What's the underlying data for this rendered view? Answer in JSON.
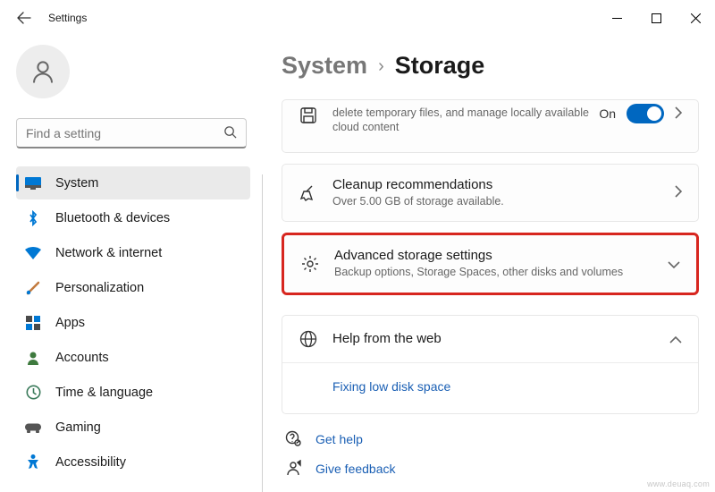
{
  "titlebar": {
    "title": "Settings"
  },
  "search": {
    "placeholder": "Find a setting"
  },
  "nav": [
    {
      "label": "System"
    },
    {
      "label": "Bluetooth & devices"
    },
    {
      "label": "Network & internet"
    },
    {
      "label": "Personalization"
    },
    {
      "label": "Apps"
    },
    {
      "label": "Accounts"
    },
    {
      "label": "Time & language"
    },
    {
      "label": "Gaming"
    },
    {
      "label": "Accessibility"
    }
  ],
  "breadcrumb": {
    "parent": "System",
    "sep": "›",
    "current": "Storage"
  },
  "cards": {
    "sense": {
      "desc": "delete temporary files, and manage locally available cloud content",
      "status": "On"
    },
    "cleanup": {
      "title": "Cleanup recommendations",
      "desc": "Over 5.00 GB of storage available."
    },
    "advanced": {
      "title": "Advanced storage settings",
      "desc": "Backup options, Storage Spaces, other disks and volumes"
    }
  },
  "help": {
    "title": "Help from the web",
    "link": "Fixing low disk space"
  },
  "footer": {
    "get_help": "Get help",
    "feedback": "Give feedback"
  },
  "watermark": "www.deuaq.com"
}
